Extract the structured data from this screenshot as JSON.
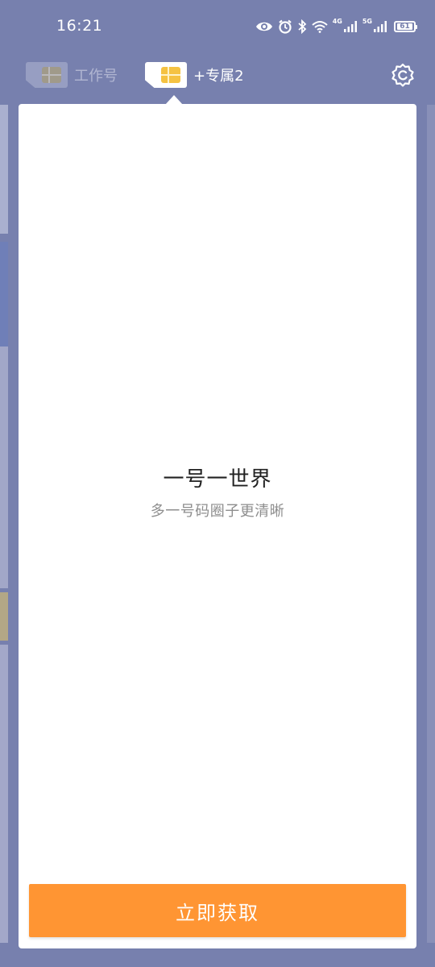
{
  "status_bar": {
    "time": "16:21",
    "net_4g": "4G",
    "net_5g": "5G",
    "battery": "61"
  },
  "sim_tabs": [
    {
      "label": "工作号",
      "state": "inactive"
    },
    {
      "label": "+专属2",
      "state": "active"
    }
  ],
  "main": {
    "title": "一号一世界",
    "subtitle": "多一号码圈子更清晰",
    "button_label": "立即获取"
  },
  "colors": {
    "background": "#7780ae",
    "accent_button": "#ff9533",
    "chip": "#f5c242"
  },
  "icons": [
    "eye-icon",
    "alarm-icon",
    "bluetooth-icon",
    "wifi-icon",
    "signal-icon",
    "battery-icon",
    "sim-card-icon",
    "settings-icon"
  ]
}
